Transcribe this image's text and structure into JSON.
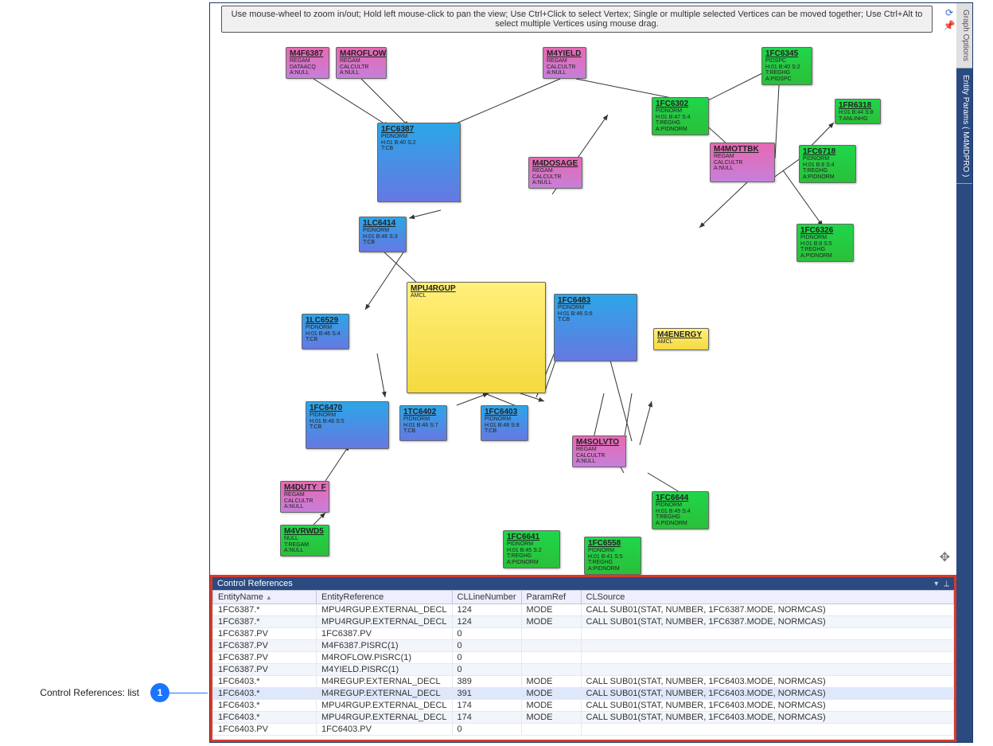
{
  "help_text": "Use mouse-wheel to zoom in/out; Hold left mouse-click to pan the view; Use Ctrl+Click to select Vertex; Single or multiple selected Vertices can be moved together; Use Ctrl+Alt to select multiple Vertices using mouse drag.",
  "sidebar": {
    "tab1": "Graph Options",
    "tab2": "Entity Params ( M4MDPRO )"
  },
  "panel_title": "Control References",
  "callout_label": "Control References: list",
  "callout_num": "1",
  "nodes": {
    "m4f6387": {
      "t": "M4F6387",
      "s1": "REGAM",
      "s2": "DATAACQ",
      "s3": "A:NULL"
    },
    "m4roflow": {
      "t": "M4ROFLOW",
      "s1": "REGAM",
      "s2": "CALCULTR",
      "s3": "A:NULL"
    },
    "m4yield": {
      "t": "M4YIELD",
      "s1": "REGAM",
      "s2": "CALCULTR",
      "s3": "A:NULL"
    },
    "n1fc6345": {
      "t": "1FC6345",
      "s1": "PIDSPC",
      "s2": "H:01 B:40 S:2",
      "s3": "T:REGHG A:PIDSPC"
    },
    "n1fr6318": {
      "t": "1FR6318",
      "s1": "",
      "s2": "H:01 B:44 S:8",
      "s3": "T:ANLINHG"
    },
    "n1fc6302": {
      "t": "1FC6302",
      "s1": "PIDNORM",
      "s2": "H:01 B:47 S:4",
      "s3": "T:REGHG A:PIDNORM"
    },
    "n1fc6718": {
      "t": "1FC6718",
      "s1": "PIDNORM",
      "s2": "H:01 B:8 S:4",
      "s3": "T:REGHG A:PIDNORM"
    },
    "n1fc6326": {
      "t": "1FC6326",
      "s1": "PIDNORM",
      "s2": "H:01 B:8 S:5",
      "s3": "T:REGHG A:PIDNORM"
    },
    "n1fc6387": {
      "t": "1FC6387",
      "s1": "PIDNORM",
      "s2": "H:01 B:40 S:2",
      "s3": "T:CB"
    },
    "n1lc6414": {
      "t": "1LC6414",
      "s1": "PIDNORM",
      "s2": "H:01 B:46 S:3",
      "s3": "T:CB"
    },
    "m4dosage": {
      "t": "M4DOSAGE",
      "s1": "REGAM",
      "s2": "CALCULTR",
      "s3": "A:NULL"
    },
    "m4mottbk": {
      "t": "M4MOTTBK",
      "s1": "REGAM",
      "s2": "CALCULTR",
      "s3": "A:NULL"
    },
    "mpu4rgup": {
      "t": "MPU4RGUP",
      "s1": "AMCL"
    },
    "n1fc6483": {
      "t": "1FC6483",
      "s1": "PIDNORM",
      "s2": "H:01 B:46 S:6",
      "s3": "T:CB"
    },
    "m4energy": {
      "t": "M4ENERGY",
      "s1": "AMCL"
    },
    "n1lc6529": {
      "t": "1LC6529",
      "s1": "PIDNORM",
      "s2": "H:01 B:46 S:4",
      "s3": "T:CB"
    },
    "n1fc6470": {
      "t": "1FC6470",
      "s1": "PIDNORM",
      "s2": "H:01 B:46 S:5",
      "s3": "T:CB"
    },
    "n1tc6402": {
      "t": "1TC6402",
      "s1": "PIDNORM",
      "s2": "H:01 B:46 S:7",
      "s3": "T:CB"
    },
    "n1fc6403": {
      "t": "1FC6403",
      "s1": "PIDNORM",
      "s2": "H:01 B:48 S:8",
      "s3": "T:CB"
    },
    "m4solvto": {
      "t": "M4SOLVTO",
      "s1": "REGAM",
      "s2": "CALCULTR",
      "s3": "A:NULL"
    },
    "n1fc6644": {
      "t": "1FC6644",
      "s1": "PIDNORM",
      "s2": "H:01 B:45 S:4",
      "s3": "T:REGHG A:PIDNORM"
    },
    "m4duty_f": {
      "t": "M4DUTY_F",
      "s1": "REGAM",
      "s2": "CALCULTR",
      "s3": "A:NULL"
    },
    "m4vrwd5": {
      "t": "M4VRWD5",
      "s1": "NULL",
      "s2": "T:REGAM A:NULL"
    },
    "n1fc6641": {
      "t": "1FC6641",
      "s1": "PIDNORM",
      "s2": "H:01 B:45 S:2",
      "s3": "T:REGHG A:PIDNORM"
    },
    "n1fc6558": {
      "t": "1FC6558",
      "s1": "PIDNORM",
      "s2": "H:01 B:41 S:5",
      "s3": "T:REGHG A:PIDNORM"
    }
  },
  "columns": {
    "c1": "EntityName",
    "c2": "EntityReference",
    "c3": "CLLineNumber",
    "c4": "ParamRef",
    "c5": "CLSource"
  },
  "rows": [
    {
      "c1": "1FC6387.*",
      "c2": "MPU4RGUP.EXTERNAL_DECL",
      "c3": "124",
      "c4": "MODE",
      "c5": "CALL SUB01(STAT, NUMBER, 1FC6387.MODE, NORMCAS)"
    },
    {
      "c1": "1FC6387.*",
      "c2": "MPU4RGUP.EXTERNAL_DECL",
      "c3": "124",
      "c4": "MODE",
      "c5": "CALL SUB01(STAT, NUMBER, 1FC6387.MODE, NORMCAS)"
    },
    {
      "c1": "1FC6387.PV",
      "c2": "1FC6387.PV",
      "c3": "0",
      "c4": "",
      "c5": ""
    },
    {
      "c1": "1FC6387.PV",
      "c2": "M4F6387.PISRC(1)",
      "c3": "0",
      "c4": "",
      "c5": ""
    },
    {
      "c1": "1FC6387.PV",
      "c2": "M4ROFLOW.PISRC(1)",
      "c3": "0",
      "c4": "",
      "c5": ""
    },
    {
      "c1": "1FC6387.PV",
      "c2": "M4YIELD.PISRC(1)",
      "c3": "0",
      "c4": "",
      "c5": ""
    },
    {
      "c1": "1FC6403.*",
      "c2": "M4REGUP.EXTERNAL_DECL",
      "c3": "389",
      "c4": "MODE",
      "c5": "CALL SUB01(STAT, NUMBER, 1FC6403.MODE, NORMCAS)"
    },
    {
      "c1": "1FC6403.*",
      "c2": "M4REGUP.EXTERNAL_DECL",
      "c3": "391",
      "c4": "MODE",
      "c5": "CALL SUB01(STAT, NUMBER, 1FC6403.MODE, NORMCAS)",
      "hover": true
    },
    {
      "c1": "1FC6403.*",
      "c2": "MPU4RGUP.EXTERNAL_DECL",
      "c3": "174",
      "c4": "MODE",
      "c5": "CALL SUB01(STAT, NUMBER, 1FC6403.MODE, NORMCAS)"
    },
    {
      "c1": "1FC6403.*",
      "c2": "MPU4RGUP.EXTERNAL_DECL",
      "c3": "174",
      "c4": "MODE",
      "c5": "CALL SUB01(STAT, NUMBER, 1FC6403.MODE, NORMCAS)"
    },
    {
      "c1": "1FC6403.PV",
      "c2": "1FC6403.PV",
      "c3": "0",
      "c4": "",
      "c5": ""
    }
  ]
}
